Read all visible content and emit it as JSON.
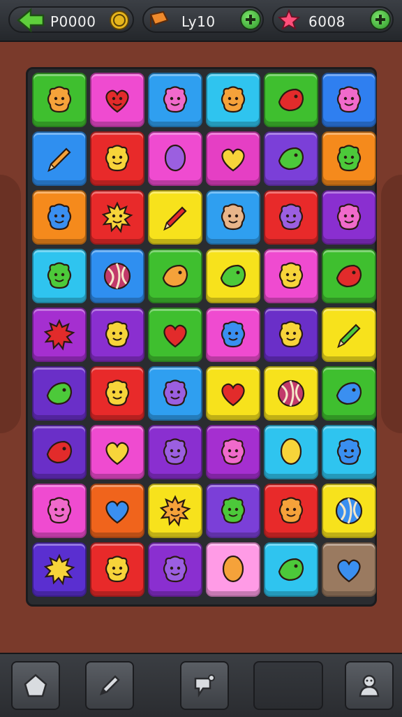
{
  "hud": {
    "coins": {
      "value": "P0000",
      "icon": "green-arrow-icon",
      "badge_icon": "gold-coin-icon"
    },
    "level": {
      "value": "Ly10",
      "icon": "orange-flag-icon"
    },
    "stars": {
      "value": "6008",
      "icon": "pink-star-icon"
    }
  },
  "board": {
    "rows": 9,
    "cols": 6,
    "tiles": [
      [
        {
          "color": "#3fbf2f",
          "icon": "orange-blob-face"
        },
        {
          "color": "#ef4bd0",
          "icon": "red-heart-face"
        },
        {
          "color": "#2f9ff0",
          "icon": "pink-blob-face"
        },
        {
          "color": "#2fc4ef",
          "icon": "orange-bear-face"
        },
        {
          "color": "#3fbf2f",
          "icon": "red-apple"
        },
        {
          "color": "#2f7ff0",
          "icon": "pink-flower-face"
        }
      ],
      [
        {
          "color": "#2f8ff0",
          "icon": "pencil"
        },
        {
          "color": "#e82a2a",
          "icon": "yellow-smile-face"
        },
        {
          "color": "#ef4bd0",
          "icon": "purple-balloon"
        },
        {
          "color": "#e53fc4",
          "icon": "yellow-heart-bow"
        },
        {
          "color": "#7b3fd8",
          "icon": "green-bird"
        },
        {
          "color": "#f58a1c",
          "icon": "green-flower-face"
        }
      ],
      [
        {
          "color": "#f58a1c",
          "icon": "blue-drop-face"
        },
        {
          "color": "#e82a2a",
          "icon": "yellow-sun-face"
        },
        {
          "color": "#f7e21c",
          "icon": "red-pencil"
        },
        {
          "color": "#2f9ff0",
          "icon": "tan-bear-face"
        },
        {
          "color": "#e82a2a",
          "icon": "purple-fruit-face"
        },
        {
          "color": "#8a2fd0",
          "icon": "pink-cat-face"
        }
      ],
      [
        {
          "color": "#2fc4ef",
          "icon": "green-smile-face"
        },
        {
          "color": "#2f8ff0",
          "icon": "striped-ball"
        },
        {
          "color": "#3fbf2f",
          "icon": "orange-fish"
        },
        {
          "color": "#f7e21c",
          "icon": "green-spinning-top"
        },
        {
          "color": "#ef4bd0",
          "icon": "yellow-smile-face"
        },
        {
          "color": "#3fbf2f",
          "icon": "red-bird"
        }
      ],
      [
        {
          "color": "#a52fd0",
          "icon": "red-sun"
        },
        {
          "color": "#8a2fd0",
          "icon": "yellow-ghost-face"
        },
        {
          "color": "#3fbf2f",
          "icon": "red-heart"
        },
        {
          "color": "#ef4bd0",
          "icon": "blue-flower-face"
        },
        {
          "color": "#6a2fc8",
          "icon": "yellow-bear-face"
        },
        {
          "color": "#f7e21c",
          "icon": "green-pencil"
        }
      ],
      [
        {
          "color": "#6a2fc8",
          "icon": "green-leaf"
        },
        {
          "color": "#e82a2a",
          "icon": "yellow-bear-face"
        },
        {
          "color": "#2f9ff0",
          "icon": "purple-blob-face"
        },
        {
          "color": "#f7e21c",
          "icon": "red-heart-arrow"
        },
        {
          "color": "#f7e21c",
          "icon": "striped-ball"
        },
        {
          "color": "#3fbf2f",
          "icon": "blue-bird"
        }
      ],
      [
        {
          "color": "#6a2fc8",
          "icon": "red-shell"
        },
        {
          "color": "#ef4bd0",
          "icon": "yellow-heart"
        },
        {
          "color": "#8a2fd0",
          "icon": "purple-blob-face"
        },
        {
          "color": "#a52fd0",
          "icon": "pink-flower-face"
        },
        {
          "color": "#2fc4ef",
          "icon": "yellow-egg"
        },
        {
          "color": "#2fc4ef",
          "icon": "blue-cat-face"
        }
      ],
      [
        {
          "color": "#ef4bd0",
          "icon": "pink-blob-face"
        },
        {
          "color": "#f0641c",
          "icon": "blue-heart"
        },
        {
          "color": "#f7e21c",
          "icon": "orange-sun-face"
        },
        {
          "color": "#7b3fd8",
          "icon": "green-fruit-face"
        },
        {
          "color": "#e82a2a",
          "icon": "orange-bear-face"
        },
        {
          "color": "#f7e21c",
          "icon": "blue-lollipop"
        }
      ],
      [
        {
          "color": "#5a2fd0",
          "icon": "yellow-sun"
        },
        {
          "color": "#e82a2a",
          "icon": "yellow-bear-face"
        },
        {
          "color": "#8a2fd0",
          "icon": "purple-fruit-face"
        },
        {
          "color": "#ff9be6",
          "icon": "orange-egg"
        },
        {
          "color": "#2fc4ef",
          "icon": "green-bird"
        },
        {
          "color": "#9a7a60",
          "icon": "blue-heart-arrow"
        }
      ]
    ]
  },
  "toolbar": {
    "buttons": [
      {
        "icon": "house-shape-icon"
      },
      {
        "icon": "pencil-icon"
      },
      {
        "icon": "speech-bubble-icon"
      },
      {
        "icon": "empty-slot"
      },
      {
        "icon": "character-icon"
      }
    ]
  },
  "palette": {
    "background": "#7a3a2b",
    "hud": "#2c2f34",
    "plus_green": "#3fa33a"
  }
}
